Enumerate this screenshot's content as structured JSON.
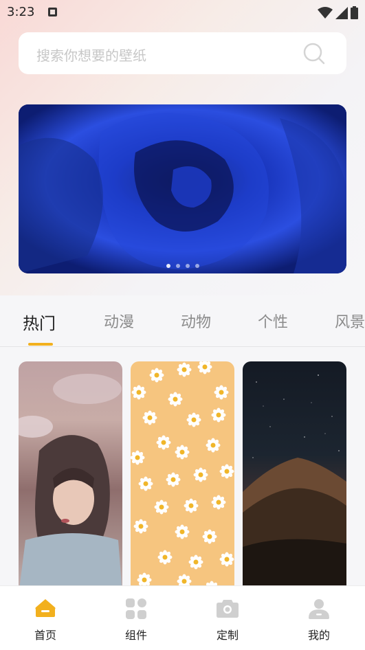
{
  "status_bar": {
    "time": "3:23",
    "icons": [
      "notification-icon",
      "wifi-icon",
      "signal-icon",
      "battery-icon"
    ]
  },
  "search": {
    "placeholder": "搜索你想要的壁纸",
    "icon": "search-icon"
  },
  "banner": {
    "image": "blue-rose-photo",
    "dot_count": 4,
    "active_dot": 0
  },
  "tabs": [
    {
      "label": "热门",
      "active": true
    },
    {
      "label": "动漫",
      "active": false
    },
    {
      "label": "动物",
      "active": false
    },
    {
      "label": "个性",
      "active": false
    },
    {
      "label": "风景",
      "active": false
    }
  ],
  "wallpapers": [
    {
      "image": "girl-portrait-photo"
    },
    {
      "image": "daisy-pattern-photo"
    },
    {
      "image": "mountain-night-sky-photo"
    }
  ],
  "bottom_nav": [
    {
      "label": "首页",
      "icon": "home-icon",
      "active": true
    },
    {
      "label": "组件",
      "icon": "widgets-icon",
      "active": false
    },
    {
      "label": "定制",
      "icon": "camera-icon",
      "active": false
    },
    {
      "label": "我的",
      "icon": "user-icon",
      "active": false
    }
  ],
  "colors": {
    "accent": "#f2b01e",
    "inactive_icon": "#cfcfcf",
    "tab_inactive": "#8b8b8b",
    "text": "#222222"
  }
}
